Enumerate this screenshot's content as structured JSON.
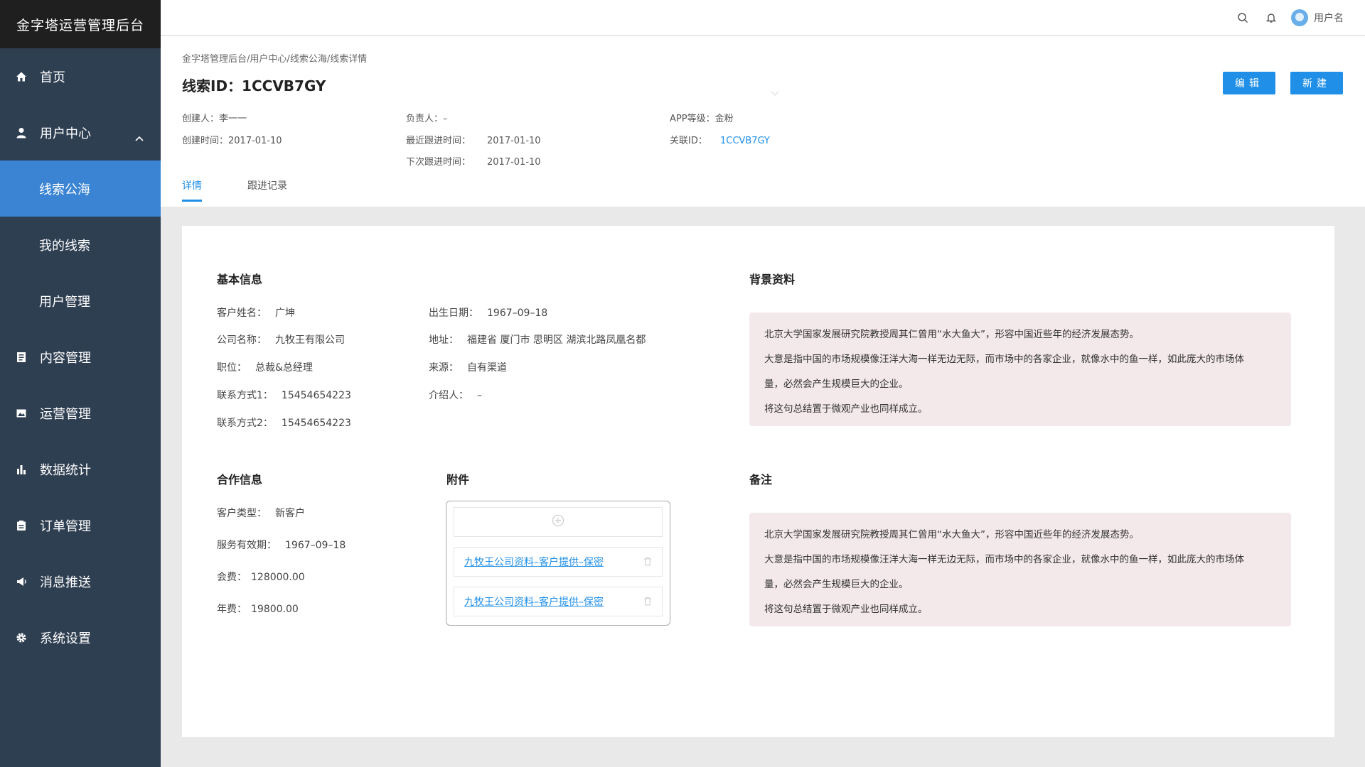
{
  "app": {
    "title": "金字塔运营管理后台"
  },
  "sidebar": {
    "items": [
      {
        "label": "首页"
      },
      {
        "label": "用户中心"
      },
      {
        "label": "线索公海"
      },
      {
        "label": "我的线索"
      },
      {
        "label": "用户管理"
      },
      {
        "label": "内容管理"
      },
      {
        "label": "运营管理"
      },
      {
        "label": "数据统计"
      },
      {
        "label": "订单管理"
      },
      {
        "label": "消息推送"
      },
      {
        "label": "系统设置"
      }
    ],
    "active": "线索公海"
  },
  "topbar": {
    "user_name": "用户名"
  },
  "breadcrumb": [
    "金字塔管理后台",
    "/",
    "用户中心",
    "/",
    "线索公海",
    "/",
    "线索详情"
  ],
  "header": {
    "title": "线索ID：1CCVB7GY",
    "edit_label": "编辑",
    "new_label": "新建",
    "meta": {
      "creator_k": "创建人：",
      "creator_v": "李一一",
      "owner_k": "负责人：",
      "owner_v": "–",
      "app_level_k": "APP等级：",
      "app_level_v": "金粉",
      "created_k": "创建时间：",
      "created_v": "2017-01-10",
      "last_follow_k": "最近跟进时间：",
      "last_follow_v": "2017-01-10",
      "related_k": "关联ID：",
      "related_v": "1CCVB7GY",
      "next_follow_k": "下次跟进时间：",
      "next_follow_v": "2017-01-10"
    },
    "tabs": [
      {
        "label": "详情"
      },
      {
        "label": "跟进记录"
      }
    ]
  },
  "basic": {
    "title": "基本信息",
    "name_k": "客户姓名：",
    "name_v": "广坤",
    "birth_k": "出生日期：",
    "birth_v": "1967–09–18",
    "company_k": "公司名称：",
    "company_v": "九牧王有限公司",
    "address_k": "地址：",
    "address_v": "福建省 厦门市 思明区 湖滨北路凤凰名都",
    "position_k": "职位：",
    "position_v": "总裁&总经理",
    "source_k": "来源：",
    "source_v": "自有渠道",
    "contact1_k": "联系方式1：",
    "contact1_v": "15454654223",
    "referrer_k": "介绍人：",
    "referrer_v": "–",
    "contact2_k": "联系方式2：",
    "contact2_v": "15454654223"
  },
  "background": {
    "title": "背景资料",
    "lines": [
      "北京大学国家发展研究院教授周其仁曾用“水大鱼大”，形容中国近些年的经济发展态势。",
      "大意是指中国的市场规模像汪洋大海一样无边无际，而市场中的各家企业，就像水中的鱼一样，如此庞大的市场体",
      "量，必然会产生规模巨大的企业。",
      "将这句总结置于微观产业也同样成立。"
    ]
  },
  "cooperation": {
    "title": "合作信息",
    "type_k": "客户类型：",
    "type_v": "新客户",
    "validity_k": "服务有效期：",
    "validity_v": "1967–09–18",
    "member_k": "会费：",
    "member_v": "128000.00",
    "annual_k": "年费：",
    "annual_v": "19800.00"
  },
  "attachments": {
    "title": "附件",
    "files": [
      {
        "name": "九牧王公司资料–客户提供–保密"
      },
      {
        "name": "九牧王公司资料–客户提供–保密"
      }
    ]
  },
  "notes": {
    "title": "备注",
    "lines": [
      "北京大学国家发展研究院教授周其仁曾用“水大鱼大”，形容中国近些年的经济发展态势。",
      "大意是指中国的市场规模像汪洋大海一样无边无际，而市场中的各家企业，就像水中的鱼一样，如此庞大的市场体",
      "量，必然会产生规模巨大的企业。",
      "将这句总结置于微观产业也同样成立。"
    ]
  },
  "colors": {
    "sidebar": "#2f3f52",
    "logo_bg": "#1f1f1f",
    "active": "#3a84d3",
    "primary": "#1f8fe8",
    "note_bg": "#f4e9ea"
  },
  "icons": [
    "home-icon",
    "user-icon",
    "document-icon",
    "image-icon",
    "bar-chart-icon",
    "order-icon",
    "megaphone-icon",
    "gear-icon",
    "search-icon",
    "bell-icon",
    "chevron-up-icon",
    "plus-circle-icon",
    "trash-icon"
  ]
}
